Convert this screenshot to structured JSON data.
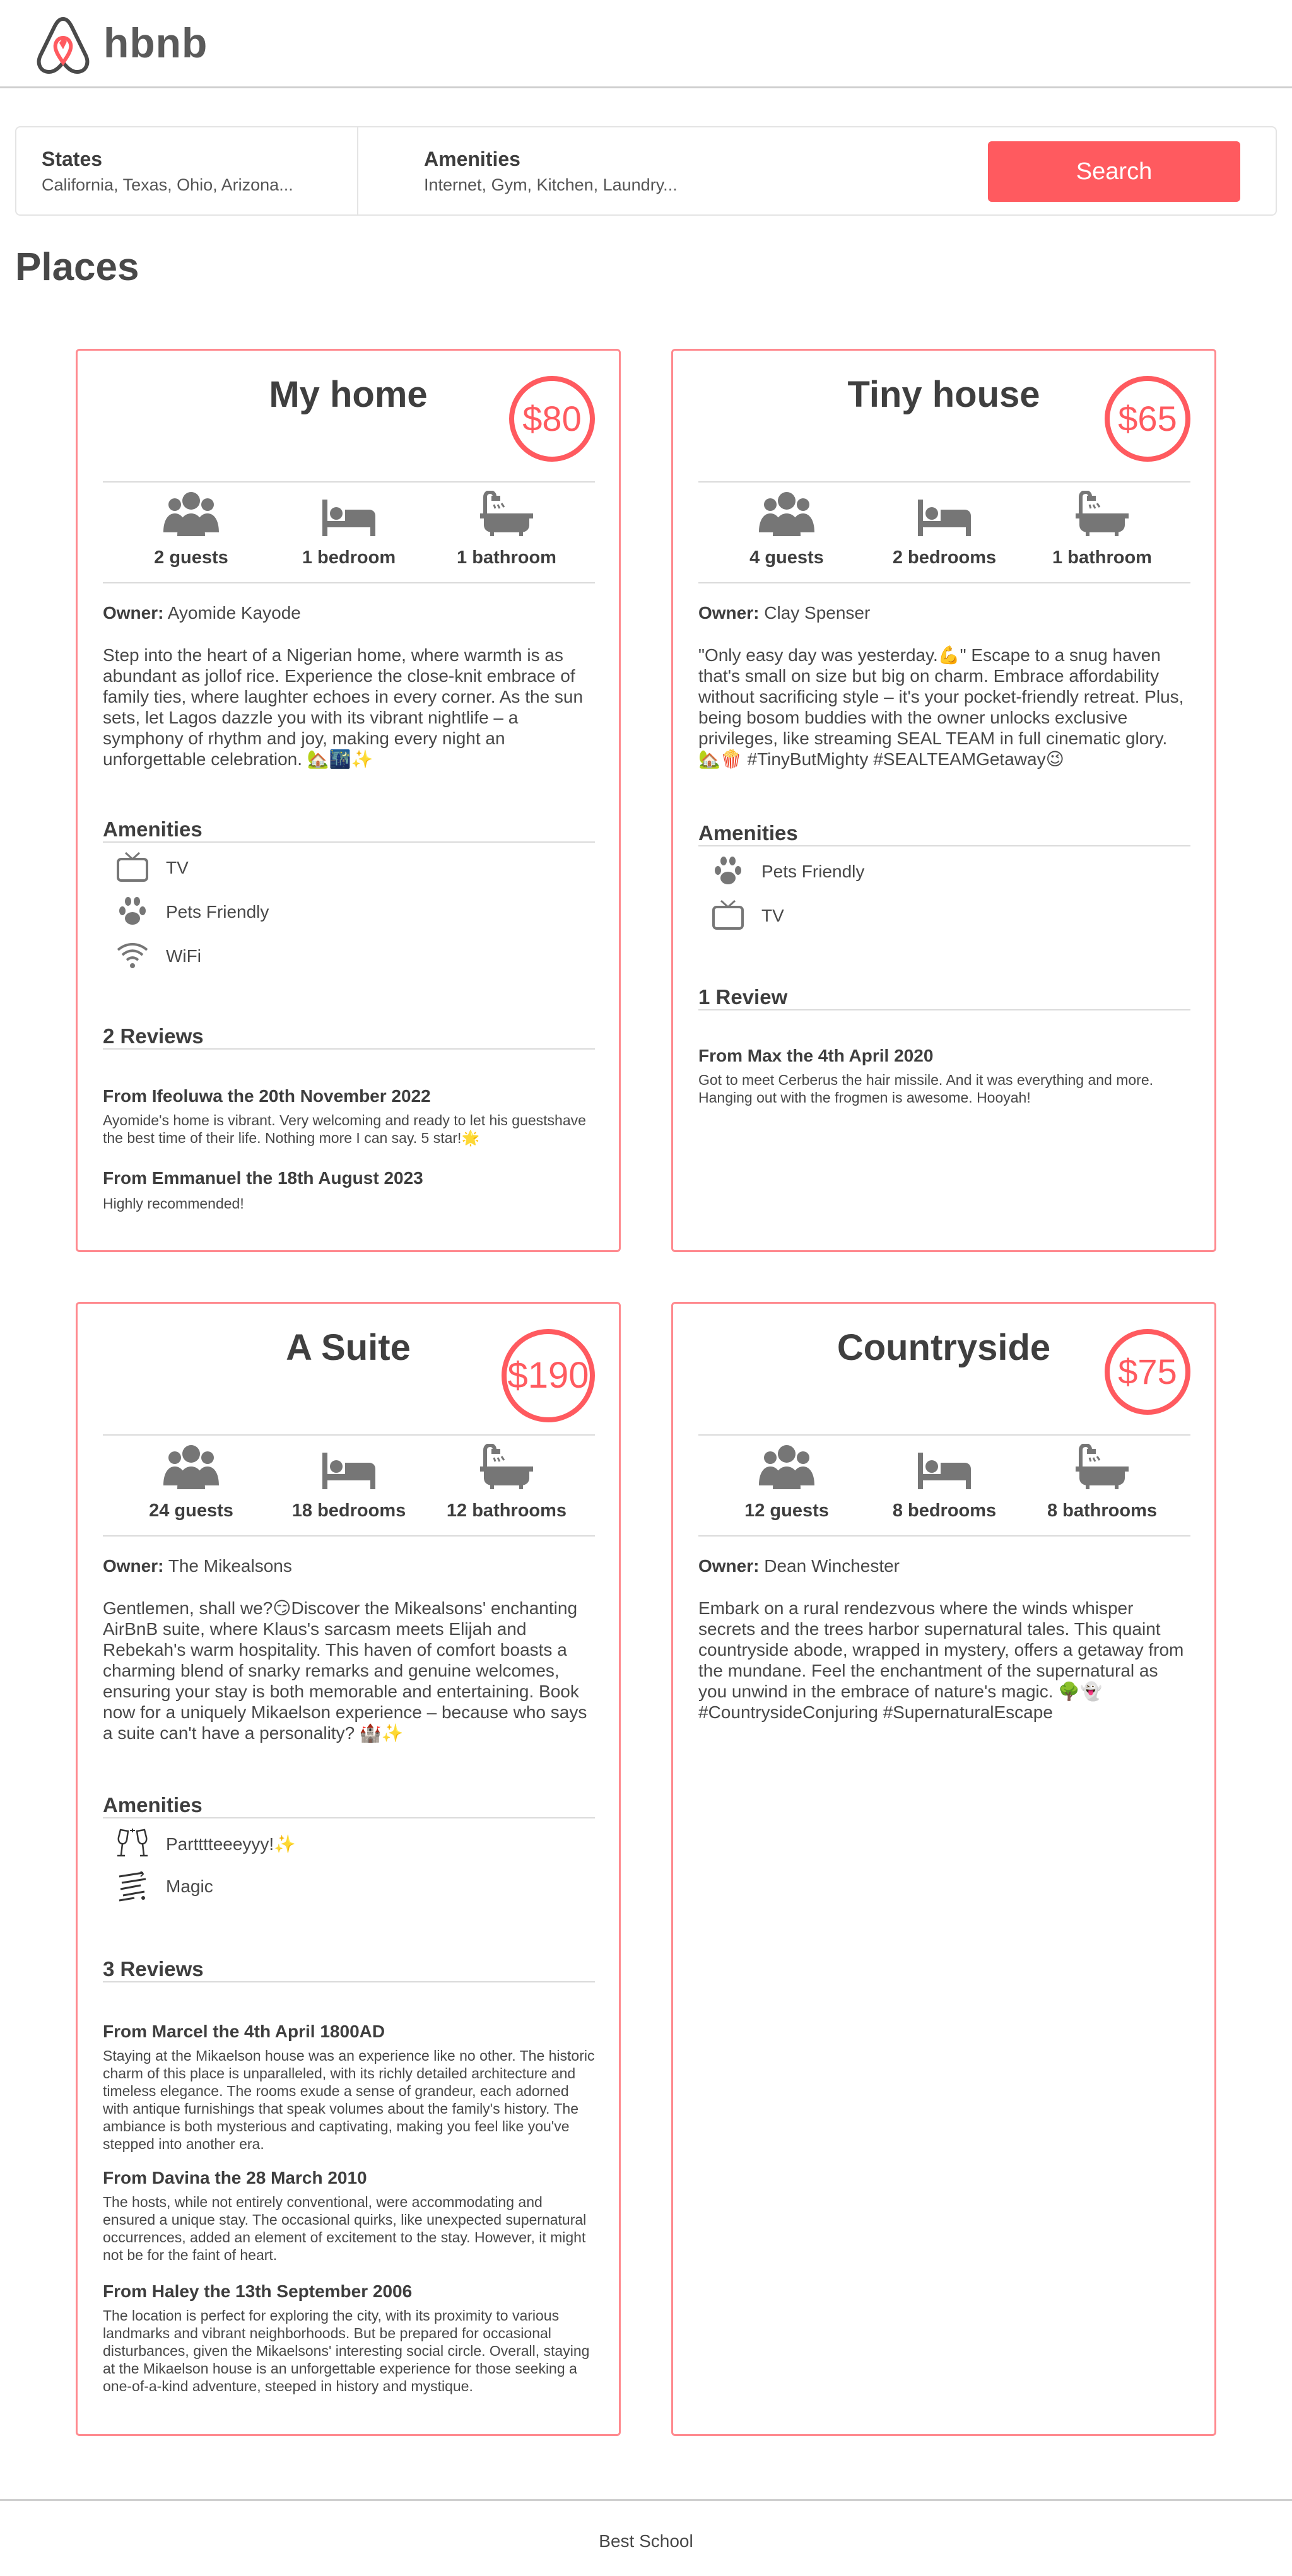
{
  "header": {
    "brand": "hbnb",
    "logo_icon": "airbnb-logo-icon",
    "accent": "#ff5a5f"
  },
  "filters": {
    "states": {
      "title": "States",
      "value": "California, Texas, Ohio, Arizona..."
    },
    "amenities": {
      "title": "Amenities",
      "value": "Internet, Gym, Kitchen, Laundry..."
    },
    "search_label": "Search"
  },
  "places_title": "Places",
  "places": [
    {
      "name": "My home",
      "price": "$80",
      "guests": "2 guests",
      "bedrooms": "1 bedroom",
      "bathrooms": "1 bathroom",
      "owner_label": "Owner:",
      "owner": "Ayomide Kayode",
      "description": "Step into the heart of a Nigerian home, where warmth is as abundant as jollof rice. Experience the close-knit embrace of family ties, where laughter echoes in every corner. As the sun sets, let Lagos dazzle you with its vibrant nightlife – a symphony of rhythm and joy, making every night an unforgettable celebration. 🏡🌃✨",
      "amenities_title": "Amenities",
      "amenities": [
        {
          "icon": "tv-icon",
          "label": "TV"
        },
        {
          "icon": "paw-icon",
          "label": "Pets Friendly"
        },
        {
          "icon": "wifi-icon",
          "label": "WiFi"
        }
      ],
      "reviews_title": "2 Reviews",
      "reviews": [
        {
          "heading": "From Ifeoluwa the 20th November 2022",
          "text": "Ayomide's home is vibrant. Very welcoming and ready to let his guestshave the best time of their life. Nothing more I can say. 5 star!🌟"
        },
        {
          "heading": "From Emmanuel the 18th August 2023",
          "text": "Highly recommended!"
        }
      ]
    },
    {
      "name": "Tiny house",
      "price": "$65",
      "guests": "4 guests",
      "bedrooms": "2 bedrooms",
      "bathrooms": "1 bathroom",
      "owner_label": "Owner:",
      "owner": "Clay Spenser",
      "description": "\"Only easy day was yesterday.💪\" Escape to a snug haven that's small on size but big on charm. Embrace affordability without sacrificing style – it's your pocket-friendly retreat. Plus, being bosom buddies with the owner unlocks exclusive privileges, like streaming SEAL TEAM in full cinematic glory. 🏡🍿 #TinyButMighty #SEALTEAMGetaway😉",
      "amenities_title": "Amenities",
      "amenities": [
        {
          "icon": "paw-icon",
          "label": "Pets Friendly"
        },
        {
          "icon": "tv-icon",
          "label": "TV"
        }
      ],
      "reviews_title": "1 Review",
      "reviews": [
        {
          "heading": "From Max the 4th April 2020",
          "text": "Got to meet Cerberus the hair missile. And it was everything and more. Hanging out with the frogmen is awesome. Hooyah!"
        }
      ]
    },
    {
      "name": "A Suite",
      "price": "$190",
      "guests": "24 guests",
      "bedrooms": "18 bedrooms",
      "bathrooms": "12 bathrooms",
      "owner_label": "Owner:",
      "owner": "The Mikealsons",
      "description": "Gentlemen, shall we?😏Discover the Mikealsons' enchanting AirBnB suite, where Klaus's sarcasm meets Elijah and Rebekah's warm hospitality. This haven of comfort boasts a charming blend of snarky remarks and genuine welcomes, ensuring your stay is both memorable and entertaining. Book now for a uniquely Mikaelson experience – because who says a suite can't have a personality? 🏰✨",
      "amenities_title": "Amenities",
      "amenities": [
        {
          "icon": "champagne-icon",
          "label": "Partttteeeyyy!✨"
        },
        {
          "icon": "magic-icon",
          "label": "Magic"
        }
      ],
      "reviews_title": "3 Reviews",
      "reviews": [
        {
          "heading": "From Marcel the 4th April 1800AD",
          "text": "Staying at the Mikaelson house was an experience like no other. The historic charm of this place is unparalleled, with its richly detailed architecture and timeless elegance. The rooms exude a sense of grandeur, each adorned with antique furnishings that speak volumes about the family's history. The ambiance is both mysterious and captivating, making you feel like you've stepped into another era."
        },
        {
          "heading": "From Davina the 28 March 2010",
          "text": "The hosts, while not entirely conventional, were accommodating and ensured a unique stay. The occasional quirks, like unexpected supernatural occurrences, added an element of excitement to the stay. However, it might not be for the faint of heart."
        },
        {
          "heading": "From Haley the 13th September 2006",
          "text": "The location is perfect for exploring the city, with its proximity to various landmarks and vibrant neighborhoods. But be prepared for occasional disturbances, given the Mikaelsons' interesting social circle. Overall, staying at the Mikaelson house is an unforgettable experience for those seeking a one-of-a-kind adventure, steeped in history and mystique."
        }
      ]
    },
    {
      "name": "Countryside",
      "price": "$75",
      "guests": "12 guests",
      "bedrooms": "8 bedrooms",
      "bathrooms": "8 bathrooms",
      "owner_label": "Owner:",
      "owner": "Dean Winchester",
      "description": "Embark on a rural rendezvous where the winds whisper secrets and the trees harbor supernatural tales. This quaint countryside abode, wrapped in mystery, offers a getaway from the mundane. Feel the enchantment of the supernatural as you unwind in the embrace of nature's magic. 🌳👻 #CountrysideConjuring #SupernaturalEscape",
      "amenities_title": "",
      "amenities": [],
      "reviews_title": "",
      "reviews": []
    }
  ],
  "footer": {
    "text": "Best School"
  }
}
